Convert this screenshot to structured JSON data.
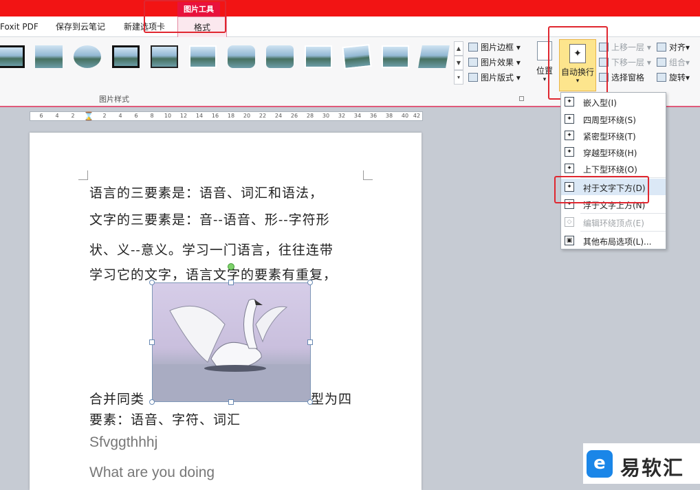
{
  "tabs": {
    "foxit": "Foxit PDF",
    "cloud": "保存到云笔记",
    "new_tab": "新建选项卡",
    "picture_tools": "图片工具",
    "format": "格式"
  },
  "ribbon": {
    "picture_styles_label": "图片样式",
    "border": "图片边框",
    "effects": "图片效果",
    "layout": "图片版式",
    "position": "位置",
    "wrap_text": "自动换行",
    "bring_forward": "上移一层",
    "send_backward": "下移一层",
    "selection_pane": "选择窗格",
    "align": "对齐",
    "group": "组合",
    "rotate": "旋转"
  },
  "ruler": [
    "6",
    "4",
    "2",
    "2",
    "4",
    "6",
    "8",
    "10",
    "12",
    "14",
    "16",
    "18",
    "20",
    "22",
    "24",
    "26",
    "28",
    "30",
    "32",
    "34",
    "36",
    "38",
    "40",
    "42"
  ],
  "document": {
    "lines": [
      "语言的三要素是：语音、词汇和语法，",
      "文字的三要素是：音--语音、形--字符形",
      "状、义--意义。学习一门语言，往往连带",
      "学习它的文字，语言文字的要素有重复，"
    ],
    "merge_left": "合并同类",
    "merge_right": "型为四",
    "line6": "要素：语音、字符、词汇",
    "line7": "Sfvggthhhj",
    "line8": "What are you doing"
  },
  "wrap_menu": [
    {
      "label": "嵌入型(I)",
      "disabled": false
    },
    {
      "label": "四周型环绕(S)",
      "disabled": false
    },
    {
      "label": "紧密型环绕(T)",
      "disabled": false
    },
    {
      "label": "穿越型环绕(H)",
      "disabled": false
    },
    {
      "label": "上下型环绕(O)",
      "disabled": false
    },
    {
      "label": "衬于文字下方(D)",
      "disabled": false
    },
    {
      "label": "浮于文字上方(N)",
      "disabled": false
    },
    {
      "label": "编辑环绕顶点(E)",
      "disabled": true
    },
    {
      "label": "其他布局选项(L)...",
      "disabled": false
    }
  ],
  "watermark": {
    "logo": "e",
    "text": "易软汇"
  },
  "colors": {
    "accent_red": "#e0262f",
    "title_red": "#f21414",
    "highlight_yellow": "#fde58d"
  }
}
